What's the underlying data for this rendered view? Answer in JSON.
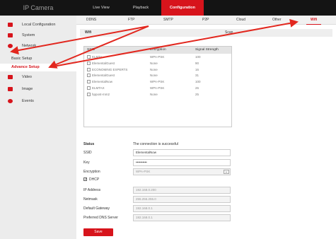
{
  "brand": "IP Camera",
  "topnav": [
    {
      "label": "Live View",
      "active": false
    },
    {
      "label": "Playback",
      "active": false
    },
    {
      "label": "Configuration",
      "active": true
    }
  ],
  "sidebar": {
    "items": [
      {
        "label": "Local Configuration",
        "icon": "monitor-icon"
      },
      {
        "label": "System",
        "icon": "system-icon"
      },
      {
        "label": "Network",
        "icon": "network-icon"
      },
      {
        "label": "Video",
        "icon": "video-icon"
      },
      {
        "label": "Image",
        "icon": "image-icon"
      },
      {
        "label": "Events",
        "icon": "events-icon"
      }
    ],
    "subitems": [
      {
        "label": "Basic Setup",
        "active": false
      },
      {
        "label": "Advance Setup",
        "active": true
      }
    ]
  },
  "tabs": [
    "DDNS",
    "FTP",
    "SMTP",
    "P2P",
    "Cloud",
    "Other",
    "Wifi"
  ],
  "active_tab": "Wifi",
  "wifi_bar": {
    "left": "Wifi",
    "right": "Scan"
  },
  "wifi_table": {
    "headers": [
      "SSID",
      "Encryption",
      "Signal Strength"
    ],
    "rows": [
      {
        "ssid": "ELMTA",
        "encryption": "WPA-PSK",
        "signal": "100"
      },
      {
        "ssid": "ElementalGuest",
        "encryption": "None",
        "signal": "90"
      },
      {
        "ssid": "ECONOMING EXPERTS",
        "encryption": "None",
        "signal": "16"
      },
      {
        "ssid": "ElementalGuest",
        "encryption": "None",
        "signal": "31"
      },
      {
        "ssid": "ElementalNow",
        "encryption": "WPA-PSK",
        "signal": "100"
      },
      {
        "ssid": "ELMTAX",
        "encryption": "WPA-PSK",
        "signal": "26"
      },
      {
        "ssid": "hppost-mm2",
        "encryption": "None",
        "signal": "25"
      }
    ]
  },
  "form": {
    "status_label": "Status",
    "status_value": "The connection is successful",
    "ssid_label": "SSID",
    "ssid_value": "ElementalNow",
    "key_label": "Key",
    "key_value": "••••••••••",
    "encryption_label": "Encryption",
    "encryption_value": "WPA-PSK",
    "dhcp_label": "DHCP",
    "dhcp_checked": true,
    "ip_label": "IP Address",
    "ip_value": "192.168.0.200",
    "netmask_label": "Netmask",
    "netmask_value": "255.255.255.0",
    "gateway_label": "Default Gateway",
    "gateway_value": "192.168.0.1",
    "dns_label": "Preferred DNS Server",
    "dns_value": "192.168.0.1"
  },
  "save_label": "Save",
  "colors": {
    "accent": "#d7141c",
    "topbar": "#141414",
    "sidebar": "#ececec"
  }
}
